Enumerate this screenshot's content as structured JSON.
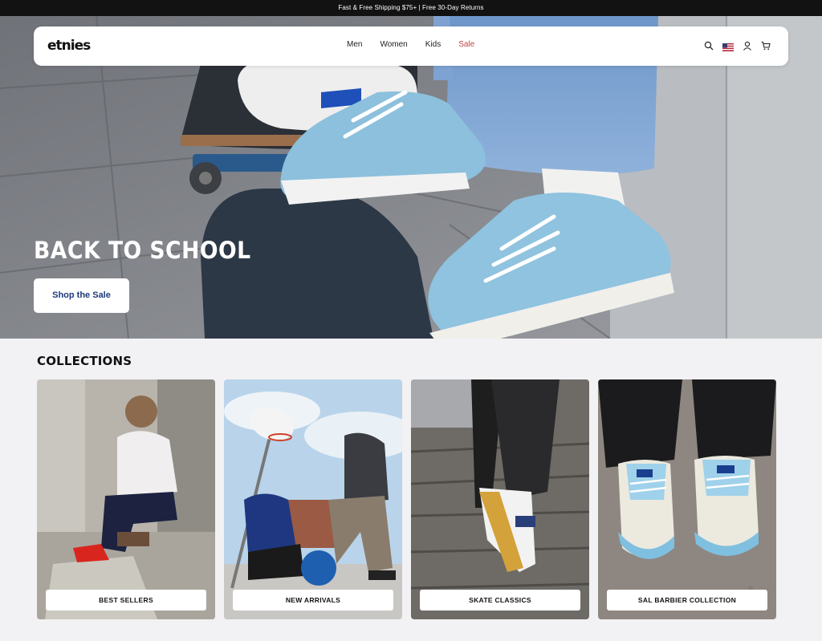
{
  "announcement": "Fast & Free Shipping $75+ | Free 30-Day Returns",
  "nav": {
    "logo": "etnies",
    "links": [
      "Men",
      "Women",
      "Kids",
      "Sale"
    ],
    "icons": [
      "search-icon",
      "us-flag-icon",
      "account-icon",
      "cart-icon"
    ]
  },
  "hero": {
    "title": "BACK TO SCHOOL",
    "button": "Shop the Sale",
    "image_alt": "skateboarders in light blue sneakers on skateboards"
  },
  "collections": {
    "title": "COLLECTIONS",
    "items": [
      {
        "label": "BEST SELLERS"
      },
      {
        "label": "NEW ARRIVALS"
      },
      {
        "label": "SKATE CLASSICS"
      },
      {
        "label": "SAL BARBIER COLLECTION"
      }
    ]
  },
  "colors": {
    "accent_sale": "#c5433e",
    "button_text": "#1d3b7a",
    "announcement_bg": "#121212"
  }
}
